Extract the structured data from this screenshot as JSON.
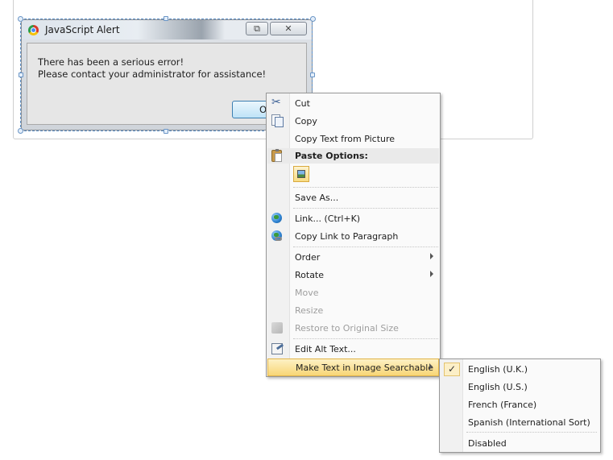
{
  "alert": {
    "title": "JavaScript Alert",
    "message_line1": "There has been a serious error!",
    "message_line2": "Please contact your administrator for assistance!",
    "ok_label": "O",
    "restore_glyph": "⧉",
    "close_glyph": "✕"
  },
  "context_menu": {
    "items": [
      {
        "label": "Cut",
        "icon": "scissors-icon",
        "disabled": false
      },
      {
        "label": "Copy",
        "icon": "copy-icon",
        "disabled": false
      },
      {
        "label": "Copy Text from Picture",
        "icon": "",
        "disabled": false
      },
      {
        "label": "Paste Options:",
        "icon": "clipboard-icon",
        "header": true
      },
      {
        "label": "Save As...",
        "icon": "",
        "disabled": false
      },
      {
        "label": "Link...  (Ctrl+K)",
        "icon": "hyperlink-icon",
        "disabled": false
      },
      {
        "label": "Copy Link to Paragraph",
        "icon": "link-paragraph-icon",
        "disabled": false
      },
      {
        "label": "Order",
        "icon": "",
        "submenu": true
      },
      {
        "label": "Rotate",
        "icon": "",
        "submenu": true
      },
      {
        "label": "Move",
        "icon": "",
        "disabled": true
      },
      {
        "label": "Resize",
        "icon": "",
        "disabled": true
      },
      {
        "label": "Restore to Original Size",
        "icon": "restore-size-icon",
        "disabled": true
      },
      {
        "label": "Edit Alt Text...",
        "icon": "alt-text-icon",
        "disabled": false
      },
      {
        "label": "Make Text in Image Searchable",
        "icon": "",
        "submenu": true,
        "highlighted": true
      }
    ]
  },
  "submenu": {
    "items": [
      {
        "label": "English (U.K.)",
        "checked": true
      },
      {
        "label": "English (U.S.)",
        "checked": false
      },
      {
        "label": "French (France)",
        "checked": false
      },
      {
        "label": "Spanish (International Sort)",
        "checked": false
      },
      {
        "label": "Disabled",
        "checked": false
      }
    ],
    "check_glyph": "✓"
  },
  "colors": {
    "highlight": "#f8d676",
    "selection_border": "#5b8fc7",
    "disabled_text": "#9e9e9e"
  }
}
